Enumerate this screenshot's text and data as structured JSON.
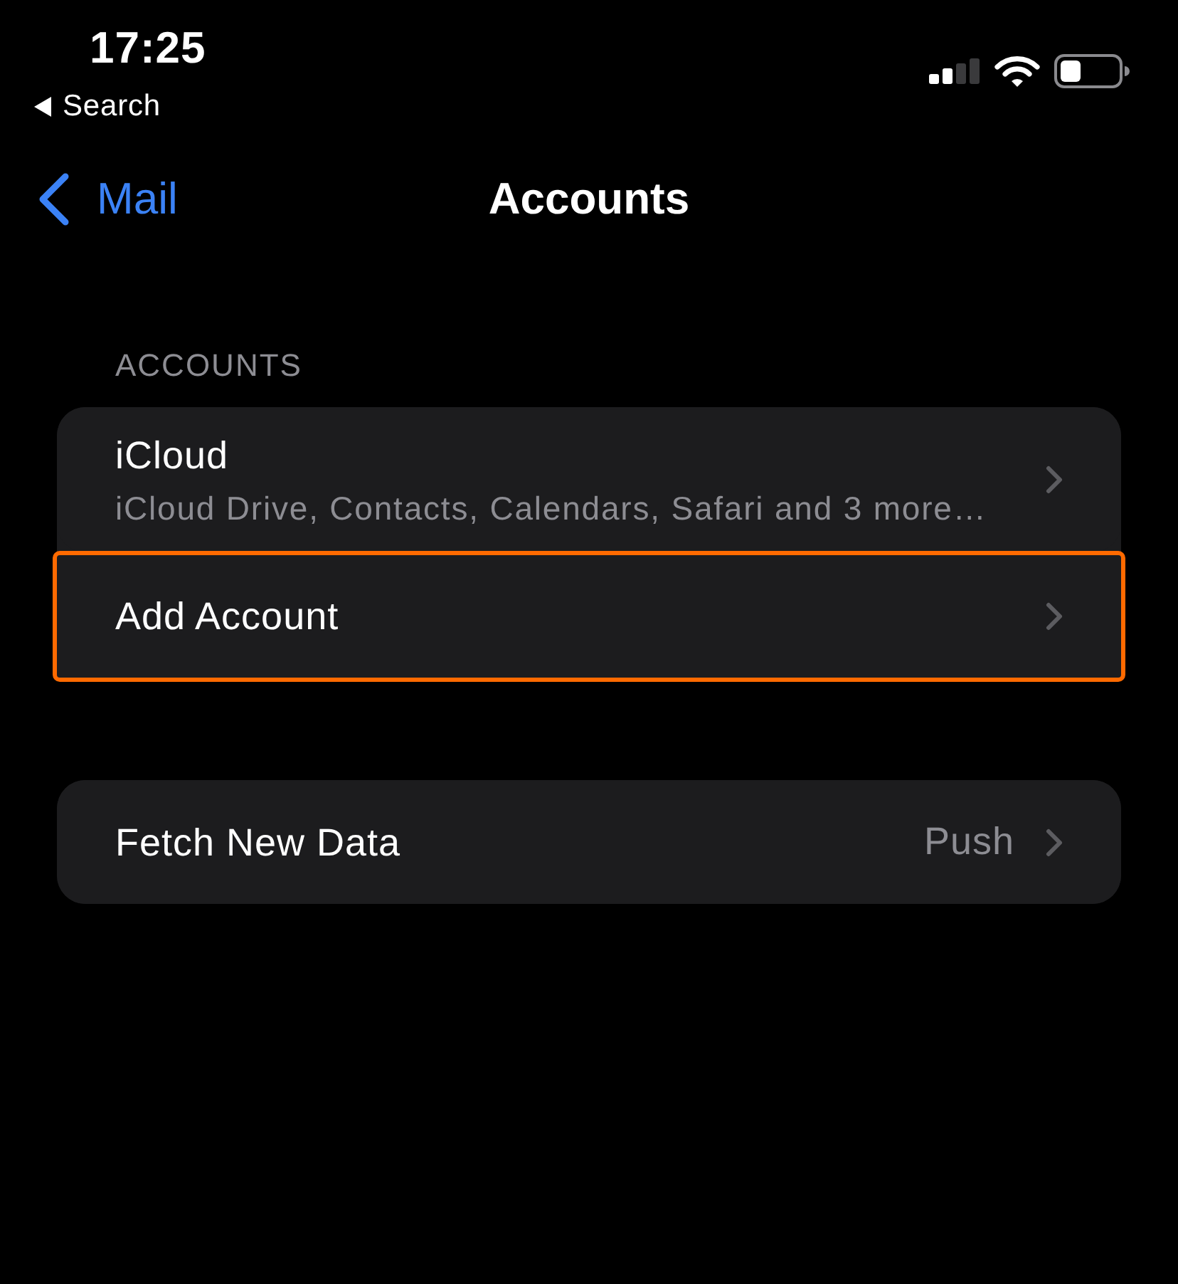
{
  "status_bar": {
    "time": "17:25",
    "back_app_label": "Search"
  },
  "nav_bar": {
    "back_label": "Mail",
    "title": "Accounts"
  },
  "sections": [
    {
      "header": "ACCOUNTS",
      "rows": [
        {
          "kind": "subtitle",
          "title": "iCloud",
          "subtitle": "iCloud Drive, Contacts, Calendars, Safari and 3 more…",
          "highlighted": false
        },
        {
          "kind": "plain",
          "title": "Add Account",
          "highlighted": true
        }
      ]
    },
    {
      "rows": [
        {
          "kind": "value",
          "title": "Fetch New Data",
          "value": "Push",
          "highlighted": false
        }
      ]
    }
  ]
}
